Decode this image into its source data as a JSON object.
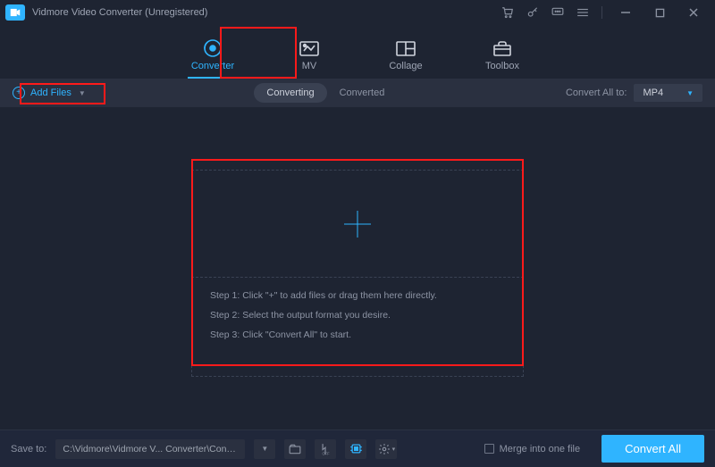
{
  "title": "Vidmore Video Converter (Unregistered)",
  "tabs": {
    "converter": "Converter",
    "mv": "MV",
    "collage": "Collage",
    "toolbox": "Toolbox"
  },
  "row2": {
    "add_files": "Add Files",
    "converting": "Converting",
    "converted": "Converted",
    "convert_all_to": "Convert All to:",
    "format": "MP4"
  },
  "drop": {
    "step1": "Step 1: Click \"+\" to add files or drag them here directly.",
    "step2": "Step 2: Select the output format you desire.",
    "step3": "Step 3: Click \"Convert All\" to start."
  },
  "footer": {
    "save_to": "Save to:",
    "path": "C:\\Vidmore\\Vidmore V... Converter\\Converted",
    "merge": "Merge into one file",
    "convert_all": "Convert All"
  }
}
